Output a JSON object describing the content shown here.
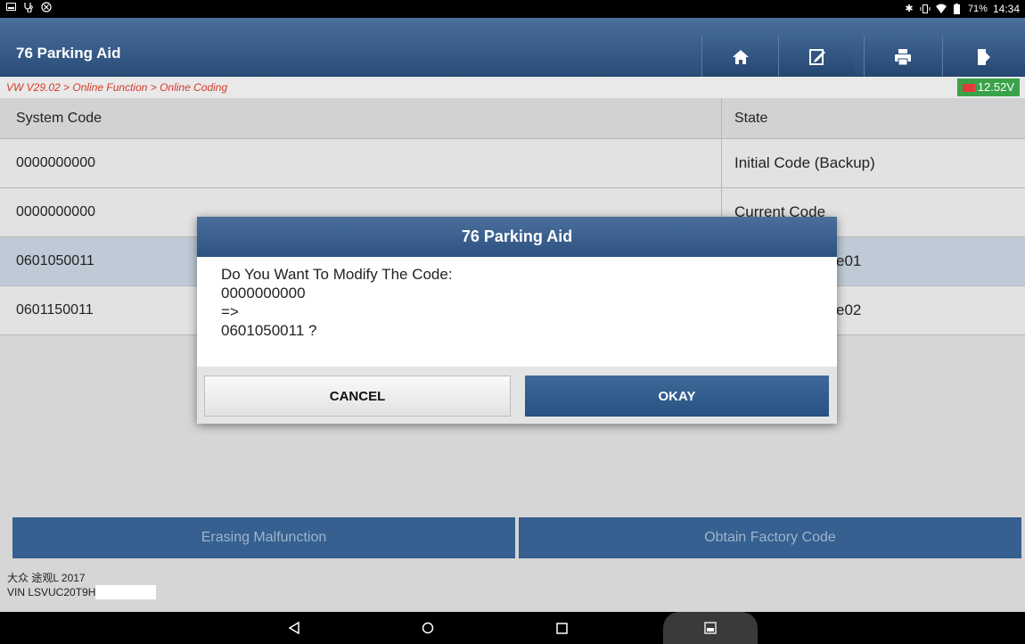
{
  "status_bar": {
    "battery": "71%",
    "time": "14:34"
  },
  "header": {
    "title": "76 Parking Aid",
    "buttons": [
      "home-icon",
      "edit-icon",
      "print-icon",
      "exit-icon"
    ]
  },
  "breadcrumb": {
    "path": "VW V29.02 > Online Function > Online Coding",
    "voltage": "12.52V"
  },
  "table": {
    "headers": {
      "code": "System Code",
      "state": "State"
    },
    "rows": [
      {
        "code": "0000000000",
        "state": "Initial Code (Backup)"
      },
      {
        "code": "0000000000",
        "state": "Current Code"
      },
      {
        "code": "0601050011",
        "state": "e01"
      },
      {
        "code": "0601150011",
        "state": "e02"
      }
    ]
  },
  "actions": {
    "erase": "Erasing Malfunction",
    "factory": "Obtain Factory Code"
  },
  "vehicle": {
    "model": "大众 途观L 2017",
    "vin": "VIN LSVUC20T9H"
  },
  "dialog": {
    "title": "76 Parking Aid",
    "line1": "Do You Want To Modify The Code:",
    "line2": "0000000000",
    "line3": "=>",
    "line4": "0601050011 ?",
    "cancel": "CANCEL",
    "okay": "OKAY"
  },
  "colors": {
    "header_blue": "#2a4d7a",
    "breadcrumb_red": "#d43a2a",
    "voltage_green": "#3aa34a",
    "action_blue": "#35608f"
  }
}
